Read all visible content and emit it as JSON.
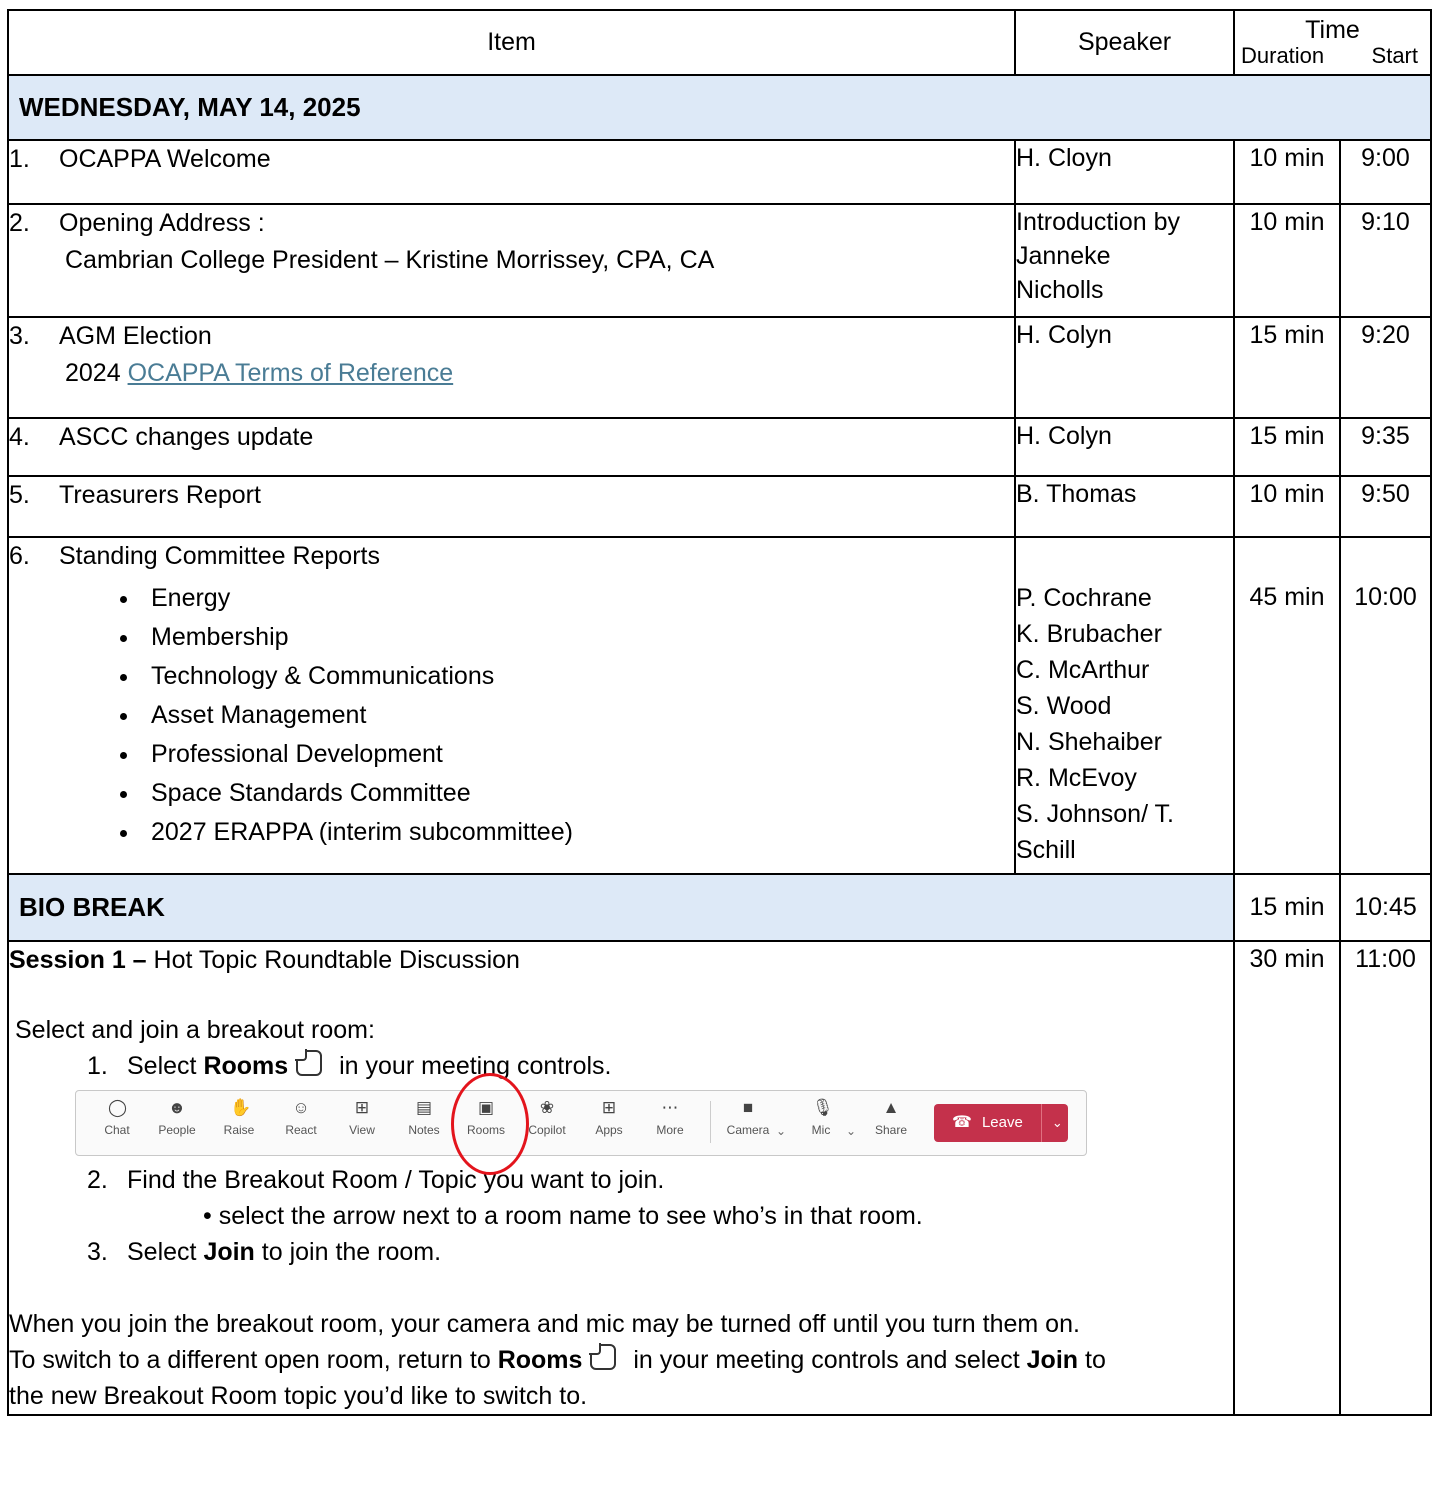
{
  "header": {
    "item": "Item",
    "speaker": "Speaker",
    "time": "Time",
    "duration": "Duration",
    "start": "Start"
  },
  "day": "WEDNESDAY, MAY 14, 2025",
  "items": [
    {
      "num": "1.",
      "title": "OCAPPA Welcome",
      "speaker": "H. Cloyn",
      "duration": "10 min",
      "start": "9:00"
    },
    {
      "num": "2.",
      "title": "Opening Address :",
      "sub": "Cambrian College President – Kristine Morrissey, CPA, CA",
      "speaker_lines": [
        "Introduction by",
        "Janneke",
        "Nicholls"
      ],
      "duration": "10 min",
      "start": "9:10"
    },
    {
      "num": "3.",
      "title": "AGM Election",
      "sub_prefix": "2024 ",
      "sub_link": "OCAPPA Terms of Reference",
      "speaker": "H. Colyn",
      "duration": "15 min",
      "start": "9:20"
    },
    {
      "num": "4.",
      "title": "ASCC changes update",
      "speaker": "H. Colyn",
      "duration": "15 min",
      "start": "9:35"
    },
    {
      "num": "5.",
      "title": "Treasurers Report",
      "speaker": "B. Thomas",
      "duration": "10 min",
      "start": "9:50"
    },
    {
      "num": "6.",
      "title": "Standing Committee Reports",
      "bullets": [
        "Energy",
        "Membership",
        "Technology & Communications",
        "Asset Management",
        "Professional Development",
        "Space Standards Committee",
        "2027 ERAPPA (interim subcommittee)"
      ],
      "speaker_lines": [
        "P. Cochrane",
        "K. Brubacher",
        "C. McArthur",
        "S. Wood",
        "N. Shehaiber",
        "R. McEvoy",
        "S. Johnson/ T.",
        "Schill"
      ],
      "duration": "45 min",
      "start": "10:00"
    }
  ],
  "break": {
    "label": "BIO BREAK",
    "duration": "15 min",
    "start": "10:45"
  },
  "session": {
    "label": "Session 1 –",
    "title": " Hot Topic Roundtable Discussion",
    "duration": "30 min",
    "start": "11:00",
    "intro": "Select and join a breakout room:",
    "step1_num": "1.",
    "step1_pre": "Select ",
    "step1_bold": "Rooms",
    "step1_post": " in your meeting controls.",
    "step2_num": "2.",
    "step2": "Find the Breakout Room  / Topic you want to join.",
    "step2_sub": "select the arrow next to a room name to see who’s in that room.",
    "step3_num": "3.",
    "step3_pre": "Select ",
    "step3_bold": "Join",
    "step3_post": " to join the room.",
    "note1": "When you join the breakout room, your camera and mic may be turned off until you turn them on.",
    "note2_pre": "To switch to a different open room, return to ",
    "note2_bold1": "Rooms",
    "note2_mid": " in your meeting controls and select ",
    "note2_bold2": "Join",
    "note2_post": " to",
    "note3": "the new Breakout Room topic you’d like to switch to."
  },
  "toolbar": {
    "buttons": [
      {
        "label": "Chat",
        "icon": "chat-icon"
      },
      {
        "label": "People",
        "icon": "people-icon"
      },
      {
        "label": "Raise",
        "icon": "raise-hand-icon"
      },
      {
        "label": "React",
        "icon": "react-icon"
      },
      {
        "label": "View",
        "icon": "view-icon"
      },
      {
        "label": "Notes",
        "icon": "notes-icon"
      },
      {
        "label": "Rooms",
        "icon": "rooms-icon"
      },
      {
        "label": "Copilot",
        "icon": "copilot-icon"
      },
      {
        "label": "Apps",
        "icon": "apps-icon"
      },
      {
        "label": "More",
        "icon": "more-icon"
      },
      {
        "label": "Camera",
        "icon": "camera-icon"
      },
      {
        "label": "Mic",
        "icon": "mic-icon"
      },
      {
        "label": "Share",
        "icon": "share-icon"
      }
    ],
    "leave": "Leave",
    "highlight_color": "#e3141c",
    "leave_color": "#c4314b"
  }
}
